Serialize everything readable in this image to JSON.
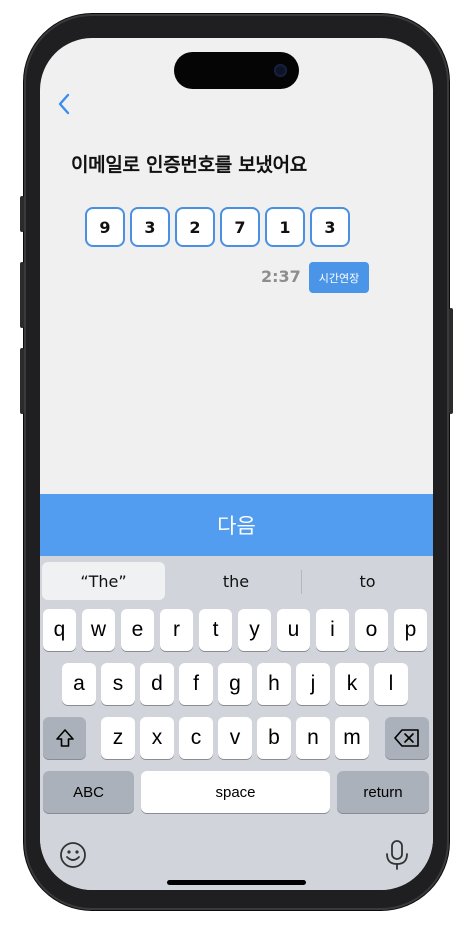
{
  "title": "이메일로 인증번호를 보냈어요",
  "code_digits": [
    "9",
    "3",
    "2",
    "7",
    "1",
    "3"
  ],
  "timer": "2:37",
  "extend_label": "시간연장",
  "next_label": "다음",
  "suggestions": [
    "“The”",
    "the",
    "to"
  ],
  "keys_row1": [
    "q",
    "w",
    "e",
    "r",
    "t",
    "y",
    "u",
    "i",
    "o",
    "p"
  ],
  "keys_row2": [
    "a",
    "s",
    "d",
    "f",
    "g",
    "h",
    "j",
    "k",
    "l"
  ],
  "keys_row3": [
    "z",
    "x",
    "c",
    "v",
    "b",
    "n",
    "m"
  ],
  "abc_label": "ABC",
  "space_label": "space",
  "return_label": "return",
  "colors": {
    "accent": "#529df0",
    "box_border": "#4a90e2",
    "keyboard_bg": "#d1d5db"
  },
  "icons": [
    "back-chevron-icon",
    "shift-icon",
    "backspace-icon",
    "emoji-icon",
    "mic-icon"
  ]
}
